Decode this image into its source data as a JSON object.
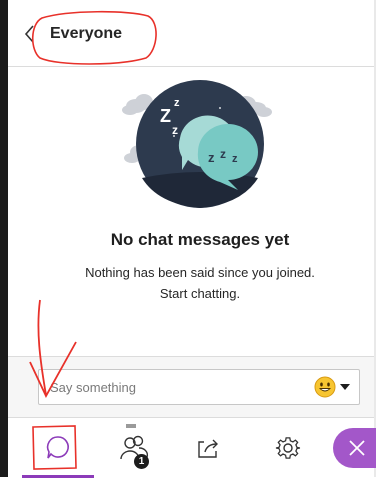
{
  "header": {
    "title": "Everyone",
    "back_icon": "chevron-left-icon"
  },
  "empty_state": {
    "title": "No chat messages yet",
    "subtitle_line1": "Nothing has been said since you joined.",
    "subtitle_line2": "Start chatting.",
    "illustration": "sleeping-chat-bubbles-illustration"
  },
  "composer": {
    "placeholder": "Say something",
    "emoji_icon": "emoji-smile-icon"
  },
  "tabs": [
    {
      "name": "chat",
      "icon": "chat-bubble-icon",
      "active": true
    },
    {
      "name": "attendees",
      "icon": "people-icon",
      "badge": "1"
    },
    {
      "name": "share-content",
      "icon": "share-icon"
    },
    {
      "name": "settings",
      "icon": "gear-icon"
    }
  ],
  "close_button": {
    "icon": "close-icon"
  },
  "colors": {
    "accent": "#a357c9",
    "annotation": "#e8312a",
    "dark_circle": "#2d3a4e",
    "bubble": "#78c9c4"
  }
}
